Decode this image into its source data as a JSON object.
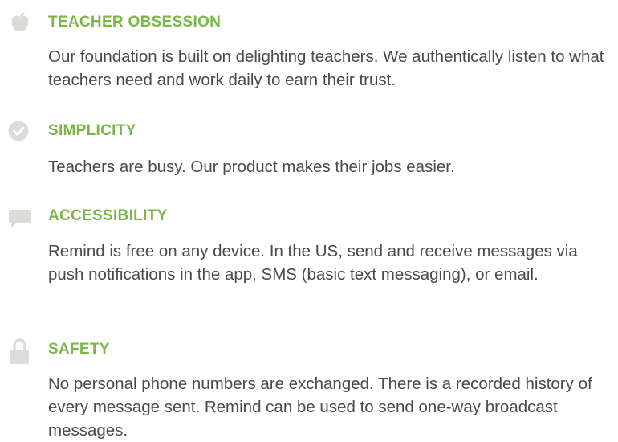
{
  "values": [
    {
      "icon": "apple-icon",
      "title": "TEACHER OBSESSION",
      "body": "Our foundation is built on delighting teachers. We authentically listen to what teachers need and work daily to earn their trust."
    },
    {
      "icon": "checkmark-circle-icon",
      "title": "SIMPLICITY",
      "body": "Teachers are busy. Our product makes their jobs easier."
    },
    {
      "icon": "chat-bubble-icon",
      "title": "ACCESSIBILITY",
      "body": "Remind is free on any device. In the US, send and receive messages via push notifications in the app, SMS (basic text messaging), or email."
    },
    {
      "icon": "padlock-icon",
      "title": "SAFETY",
      "body": "No personal phone numbers are exchanged. There is a recorded history of every message sent. Remind can be used to send one-way broadcast messages."
    }
  ],
  "colors": {
    "title": "#7ab648",
    "body_text": "#4a4a4a",
    "icon": "#dcdcd8"
  }
}
